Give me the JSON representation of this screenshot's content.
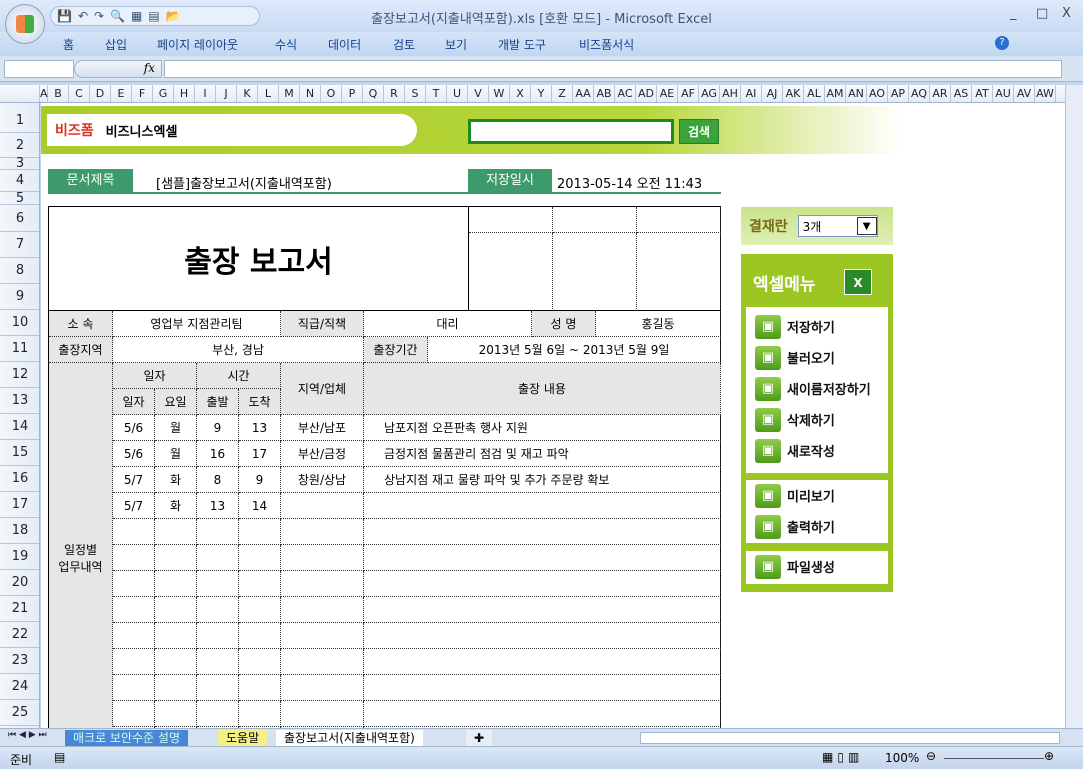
{
  "window": {
    "title": "출장보고서(지출내역포함).xls  [호환 모드] - Microsoft Excel",
    "minimize": "_",
    "maximize": "□",
    "close": "X"
  },
  "ribbon_tabs": [
    "홈",
    "삽입",
    "페이지 레이아웃",
    "수식",
    "데이터",
    "검토",
    "보기",
    "개발 도구",
    "비즈폼서식"
  ],
  "formula_bar": {
    "fx": "fx",
    "name_box": "",
    "formula": ""
  },
  "columns": [
    "A",
    "B",
    "C",
    "D",
    "E",
    "F",
    "G",
    "H",
    "I",
    "J",
    "K",
    "L",
    "M",
    "N",
    "O",
    "P",
    "Q",
    "R",
    "S",
    "T",
    "U",
    "V",
    "W",
    "X",
    "Y",
    "Z",
    "AA",
    "AB",
    "AC",
    "AD",
    "AE",
    "AF",
    "AG",
    "AH",
    "AI",
    "AJ",
    "AK",
    "AL",
    "AM",
    "AN",
    "AO",
    "AP",
    "AQ",
    "AR",
    "AS",
    "AT",
    "AU",
    "AV",
    "AW"
  ],
  "rows": [
    "1",
    "2",
    "3",
    "4",
    "5",
    "6",
    "7",
    "8",
    "9",
    "10",
    "11",
    "12",
    "13",
    "14",
    "15",
    "16",
    "17",
    "18",
    "19",
    "20",
    "21",
    "22",
    "23",
    "24",
    "25"
  ],
  "banner": {
    "brand": "비즈폼",
    "brand2": "비즈니스엑셀",
    "title": "엑셀데이터 서식",
    "search_placeholder": "",
    "search_button": "검색"
  },
  "doc": {
    "title_label": "문서제목",
    "title_value": "[샘플]출장보고서(지출내역포함)",
    "saved_label": "저장일시",
    "saved_value": "2013-05-14  오전 11:43"
  },
  "report": {
    "heading": "출장 보고서",
    "dept_label": "소  속",
    "dept": "영업부 지점관리팀",
    "rank_label": "직급/직책",
    "rank": "대리",
    "name_label": "성  명",
    "name": "홍길동",
    "region_label": "출장지역",
    "region": "부산, 경남",
    "period_label": "출장기간",
    "period": "2013년 5월 6일  ~  2013년 5월 9일",
    "schedule_label": "일정별 업무내역",
    "h_date": "일자",
    "h_time": "시간",
    "h_day": "일자",
    "h_weekday": "요일",
    "h_depart": "출발",
    "h_arrive": "도착",
    "h_place": "지역/업체",
    "h_content": "출장 내용",
    "entries": [
      {
        "date": "5/6",
        "weekday": "월",
        "depart": "9",
        "arrive": "13",
        "place": "부산/남포",
        "content": "남포지점 오픈판촉 행사 지원"
      },
      {
        "date": "5/6",
        "weekday": "월",
        "depart": "16",
        "arrive": "17",
        "place": "부산/금정",
        "content": "금정지점 물품관리 점검 및 재고 파악"
      },
      {
        "date": "5/7",
        "weekday": "화",
        "depart": "8",
        "arrive": "9",
        "place": "창원/상남",
        "content": "상남지점 재고 물량 파악 및 추가 주문량 확보"
      },
      {
        "date": "5/7",
        "weekday": "화",
        "depart": "13",
        "arrive": "14",
        "place": "",
        "content": ""
      }
    ]
  },
  "approval": {
    "label": "결재란",
    "value": "3개"
  },
  "menu": {
    "title": "엑셀메뉴",
    "group1": [
      "저장하기",
      "불러오기",
      "새이름저장하기",
      "삭제하기",
      "새로작성"
    ],
    "group2": [
      "미리보기",
      "출력하기"
    ],
    "group3": [
      "파일생성"
    ]
  },
  "sheet_tabs": [
    "매크로 보안수준 설명",
    "도움말",
    "출장보고서(지출내역포함)"
  ],
  "status": {
    "ready": "준비",
    "zoom": "100%"
  }
}
